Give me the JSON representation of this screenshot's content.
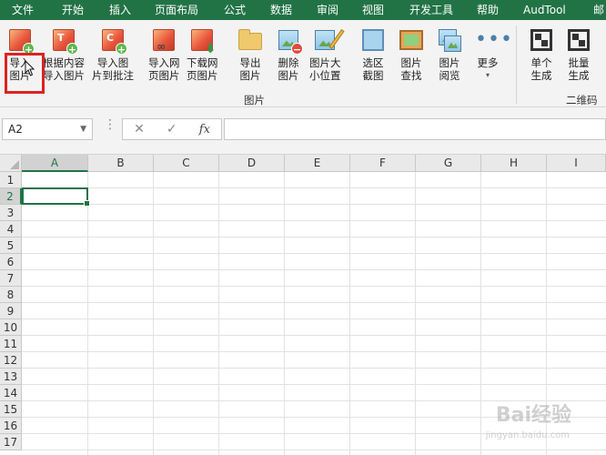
{
  "menu": [
    "文件",
    "开始",
    "插入",
    "页面布局",
    "公式",
    "数据",
    "审阅",
    "视图",
    "开发工具",
    "帮助",
    "AudTool",
    "邮"
  ],
  "ribbon": {
    "buttons": [
      {
        "label": "导入\n图片",
        "icon": "import-picture-icon"
      },
      {
        "label": "根据内容\n导入图片",
        "icon": "import-by-content-icon"
      },
      {
        "label": "导入图\n片到批注",
        "icon": "import-to-comment-icon"
      },
      {
        "label": "导入网\n页图片",
        "icon": "import-web-picture-icon"
      },
      {
        "label": "下载网\n页图片",
        "icon": "download-web-picture-icon"
      },
      {
        "label": "导出\n图片",
        "icon": "export-picture-icon"
      },
      {
        "label": "删除\n图片",
        "icon": "delete-picture-icon"
      },
      {
        "label": "图片大\n小位置",
        "icon": "picture-size-position-icon"
      },
      {
        "label": "选区\n截图",
        "icon": "selection-screenshot-icon"
      },
      {
        "label": "图片\n查找",
        "icon": "picture-find-icon"
      },
      {
        "label": "图片\n阅览",
        "icon": "picture-preview-icon"
      },
      {
        "label": "更多",
        "icon": "more-icon"
      },
      {
        "label": "单个\n生成",
        "icon": "single-qrcode-icon"
      },
      {
        "label": "批量\n生成",
        "icon": "batch-qrcode-icon"
      }
    ],
    "group_picture": "图片",
    "group_qrcode": "二维码"
  },
  "formula_bar": {
    "name_box": "A2",
    "cancel": "✕",
    "confirm": "✓",
    "fx": "fx",
    "value": ""
  },
  "sheet": {
    "columns": [
      "A",
      "B",
      "C",
      "D",
      "E",
      "F",
      "G",
      "H",
      "I"
    ],
    "rows": [
      "1",
      "2",
      "3",
      "4",
      "5",
      "6",
      "7",
      "8",
      "9",
      "10",
      "11",
      "12",
      "13",
      "14",
      "15",
      "16",
      "17"
    ],
    "active_cell": "A2"
  },
  "watermark": {
    "text": "Bai经验",
    "sub": "jingyan.baidu.com"
  },
  "colors": {
    "accent": "#217346",
    "highlight": "#dd2222"
  }
}
